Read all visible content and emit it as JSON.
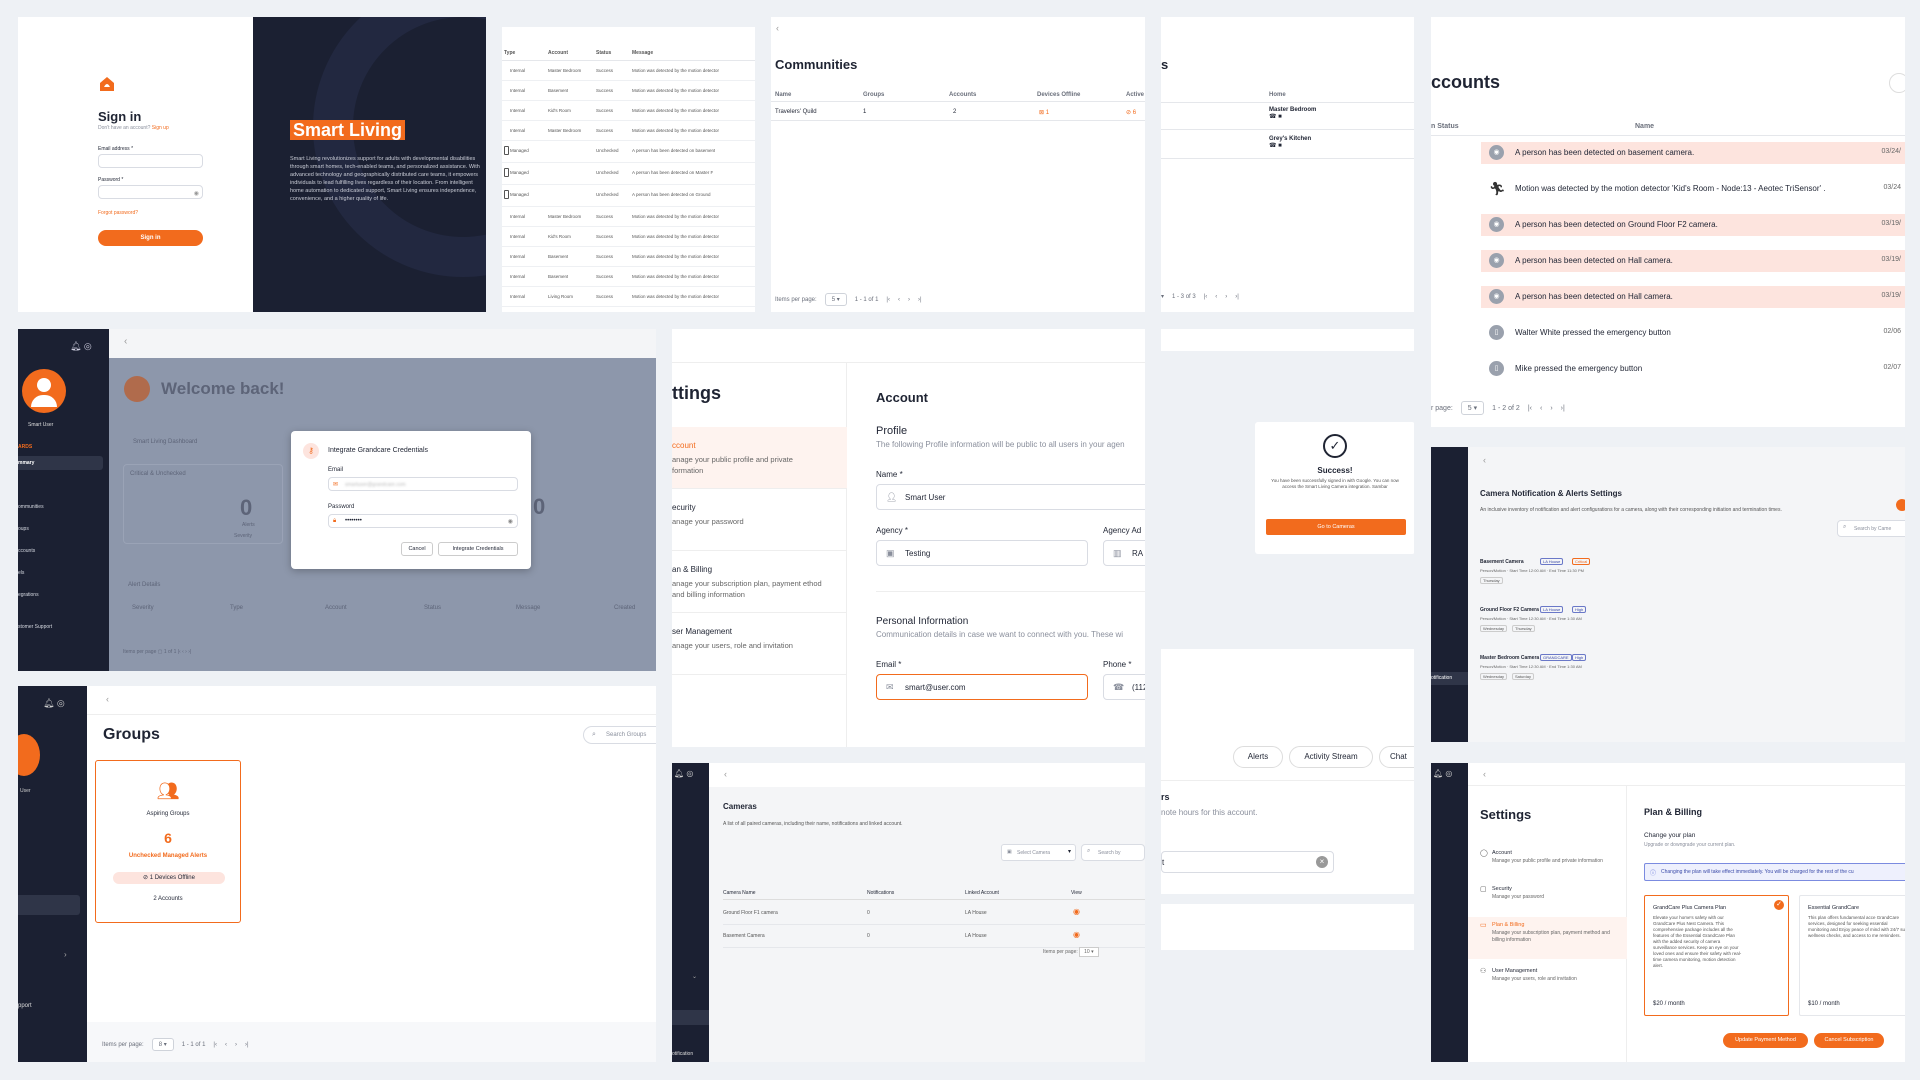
{
  "colors": {
    "accent": "#f26b1d",
    "navy": "#1b2032",
    "bg": "#eef1f5",
    "alert_row": "#fde4de"
  },
  "signin": {
    "title": "Sign in",
    "subtitle": "Don't have an account?",
    "signup": "Sign up",
    "email_label": "Email address *",
    "password_label": "Password *",
    "forgot": "Forgot password?",
    "button": "Sign in",
    "brand": "Smart Living",
    "description": "Smart Living revolutionizes support for adults with developmental disabilities through smart homes, tech-enabled teams, and personalized assistance. With advanced technology and geographically distributed care teams, it empowers individuals to lead fulfilling lives regardless of their location. From intelligent home automation to dedicated support, Smart Living ensures independence, convenience, and a higher quality of life."
  },
  "alerts_table": {
    "headers": [
      "Type",
      "Account",
      "Status",
      "Message"
    ],
    "rows": [
      [
        "Internal",
        "Master Bedroom",
        "Success",
        "Motion was detected by the motion detector"
      ],
      [
        "Internal",
        "Basement",
        "Success",
        "Motion was detected by the motion detector"
      ],
      [
        "Internal",
        "Kid's Room",
        "Success",
        "Motion was detected by the motion detector"
      ],
      [
        "Internal",
        "Master Bedroom",
        "Success",
        "Motion was detected by the motion detector"
      ],
      [
        "Managed",
        "",
        "Unchecked",
        "A person has been detected on basement"
      ],
      [
        "Managed",
        "",
        "Unchecked",
        "A person has been detected on Master F"
      ],
      [
        "Managed",
        "",
        "Unchecked",
        "A person has been detected on Ground"
      ],
      [
        "Internal",
        "Master Bedroom",
        "Success",
        "Motion was detected by the motion detector"
      ],
      [
        "Internal",
        "Kid's Room",
        "Success",
        "Motion was detected by the motion detector"
      ],
      [
        "Internal",
        "Basement",
        "Success",
        "Motion was detected by the motion detector"
      ],
      [
        "Internal",
        "Basement",
        "Success",
        "Motion was detected by the motion detector"
      ],
      [
        "Internal",
        "Living Room",
        "Success",
        "Motion was detected by the motion detector"
      ]
    ]
  },
  "communities": {
    "title": "Communities",
    "headers": [
      "Name",
      "Groups",
      "Accounts",
      "Devices Offline",
      "Active"
    ],
    "rows": [
      [
        "Travelers' Quild",
        "1",
        "2",
        "1",
        "6"
      ]
    ],
    "items_per_page": "Items per page:",
    "page_size": "5",
    "range": "1 - 1 of 1"
  },
  "home_panel": {
    "header": "Home",
    "items": [
      "Master Bedroom",
      "Grey's Kitchen"
    ],
    "range": "1 - 3 of 3",
    "title_fragment": "s"
  },
  "accounts_feed": {
    "title": "ccounts",
    "col_status": "n Status",
    "col_name": "Name",
    "items": [
      {
        "text": "A person has been detected on basement camera.",
        "date": "03/24/",
        "alert": true,
        "icon": "camera-icon"
      },
      {
        "text": "Motion was detected by the motion detector 'Kid's Room - Node:13 - Aeotec TriSensor' .",
        "date": "03/24",
        "alert": false,
        "icon": "running-person-icon"
      },
      {
        "text": "A person has been detected on Ground Floor F2 camera.",
        "date": "03/19/",
        "alert": true,
        "icon": "camera-icon"
      },
      {
        "text": "A person has been detected on Hall camera.",
        "date": "03/19/",
        "alert": true,
        "icon": "camera-icon"
      },
      {
        "text": "A person has been detected on Hall camera.",
        "date": "03/19/",
        "alert": true,
        "icon": "camera-icon"
      },
      {
        "text": "Walter White pressed the emergency button",
        "date": "02/06",
        "alert": false,
        "icon": "phone-icon"
      },
      {
        "text": "Mike pressed the emergency button",
        "date": "02/07",
        "alert": false,
        "icon": "phone-icon"
      }
    ],
    "per_page": "r page:",
    "page_size": "5",
    "range": "1 - 2 of 2"
  },
  "dashboard": {
    "user": "Smart User",
    "section": "ARDS",
    "active": "mmary",
    "nav": [
      "ommunities",
      "oups",
      "ccounts",
      "els",
      "egrations",
      "stomer Support"
    ],
    "welcome": "Welcome back!",
    "dash_label": "Smart Living Dashboard",
    "card1": "Critical & Unchecked",
    "zero": "0",
    "alerts": "Alerts",
    "severity": "Severity",
    "alert_details": "Alert Details",
    "cols": [
      "Severity",
      "Type",
      "Account",
      "Status",
      "Message",
      "Created"
    ],
    "modal": {
      "title": "Integrate Grandcare Credentials",
      "email_label": "Email",
      "email_value": "smartuser@grandcare.com",
      "password_label": "Password",
      "password_value": "••••••••",
      "cancel": "Cancel",
      "submit": "Integrate Credentials"
    }
  },
  "settings_account": {
    "title": "ttings",
    "menu": [
      {
        "label": "ccount",
        "desc": "anage your public profile and private formation",
        "active": true
      },
      {
        "label": "ecurity",
        "desc": "anage your password",
        "active": false
      },
      {
        "label": "an & Billing",
        "desc": "anage your subscription plan, payment ethod and billing information",
        "active": false
      },
      {
        "label": "ser Management",
        "desc": "anage your users, role and invitation",
        "active": false
      }
    ],
    "heading": "Account",
    "profile": "Profile",
    "profile_desc": "The following Profile information will be public to all users in your agen",
    "name_label": "Name *",
    "name_value": "Smart User",
    "agency_label": "Agency *",
    "agency_value": "Testing",
    "agency_addr_label": "Agency Ad",
    "agency_addr_value": "RA",
    "personal": "Personal Information",
    "personal_desc": "Communication details in case we want to connect with you. These wi",
    "email_label": "Email *",
    "email_value": "smart@user.com",
    "phone_label": "Phone *",
    "phone_value": "(112"
  },
  "success": {
    "title": "Success!",
    "message": "You have been successfully signed in with Google. You can now access the Smart Living Camera integration. Sambar",
    "button": "Go to Cameras"
  },
  "tabs_panel": {
    "tabs": [
      "Alerts",
      "Activity Stream",
      "Chat"
    ],
    "title_fragment": "rs",
    "desc": "note hours for this account.",
    "input_fragment": "t"
  },
  "camera_settings": {
    "title": "Camera Notification & Alerts Settings",
    "desc": "An inclusive inventory of notification and alert configurations for a camera, along with their corresponding initiation and termination times.",
    "search": "Search by Came",
    "nav_active": "otification",
    "cameras": [
      {
        "name": "Basement Camera",
        "tags": [
          "LA House",
          "Critical"
        ],
        "detail": "Person/Motion  ·  Start Time 12:00 AM  ·  End Time 11:30 PM",
        "days": [
          "Thursday"
        ]
      },
      {
        "name": "Ground Floor F2 Camera",
        "tags": [
          "LA House",
          "High"
        ],
        "detail": "Person/Motion  ·  Start Time 12:30 AM  ·  End Time 1:30 AM",
        "days": [
          "Wednesday",
          "Thursday"
        ]
      },
      {
        "name": "Master Bedroom Camera",
        "tags": [
          "GRANDCARE",
          "High"
        ],
        "detail": "Person/Motion  ·  Start Time 12:30 AM  ·  End Time 1:30 AM",
        "days": [
          "Wednesday",
          "Saturday"
        ]
      }
    ]
  },
  "groups": {
    "title": "Groups",
    "search": "Search Groups",
    "user": "User",
    "nav_bottom": "pport",
    "card": {
      "name": "Aspiring Groups",
      "count": "6",
      "alerts_label": "Unchecked Managed Alerts",
      "offline": "1 Devices Offline",
      "accounts": "2 Accounts"
    },
    "items_per_page": "Items per page:",
    "page_size": "8",
    "range": "1 - 1 of 1"
  },
  "cameras": {
    "title": "Cameras",
    "desc": "A list of all paired cameras, including their name, notifications and linked account.",
    "select": "Select Camera",
    "search": "Search by",
    "headers": [
      "Camera Name",
      "Notifications",
      "Linked Account",
      "View"
    ],
    "rows": [
      [
        "Ground Floor F1 camera",
        "0",
        "LA House"
      ],
      [
        "Basement Camera",
        "0",
        "LA House"
      ]
    ],
    "items_per_page": "Items per page:",
    "page_size": "10",
    "nav_bottom": "otification"
  },
  "billing": {
    "title": "Settings",
    "menu": [
      {
        "label": "Account",
        "desc": "Manage your public profile and private information",
        "icon": "user-icon"
      },
      {
        "label": "Security",
        "desc": "Manage your password",
        "icon": "lock-icon"
      },
      {
        "label": "Plan & Billing",
        "desc": "Manage your subscription plan, payment method and billing information",
        "icon": "card-icon",
        "active": true
      },
      {
        "label": "User Management",
        "desc": "Manage your users, role and invitation",
        "icon": "users-icon"
      }
    ],
    "heading": "Plan & Billing",
    "change": "Change your plan",
    "change_desc": "Upgrade or downgrade your current plan.",
    "notice": "Changing the plan will take effect immediately. You will be charged for the rest of the cu",
    "plans": [
      {
        "name": "GrandCare Plus Camera Plan",
        "desc": "Elevate your home's safety with our GrandCare Plus Nest Camera. This comprehensive package includes all the features of the Essential GrandCare Plan with the added security of camera surveillance services. Keep an eye on your loved ones and ensure their safety with real-time camera monitoring, motion detection alert.",
        "price": "$20 / month",
        "selected": true
      },
      {
        "name": "Essential GrandCare",
        "desc": "This plan offers fundamental acce GrandCare services, designed for seeking essential monitoring and Enjoy peace of mind with 24/7 sup wellness checks, and access to me reminders.",
        "price": "$10 / month",
        "selected": false
      }
    ],
    "update": "Update Payment Method",
    "cancel": "Cancel Subscription"
  }
}
